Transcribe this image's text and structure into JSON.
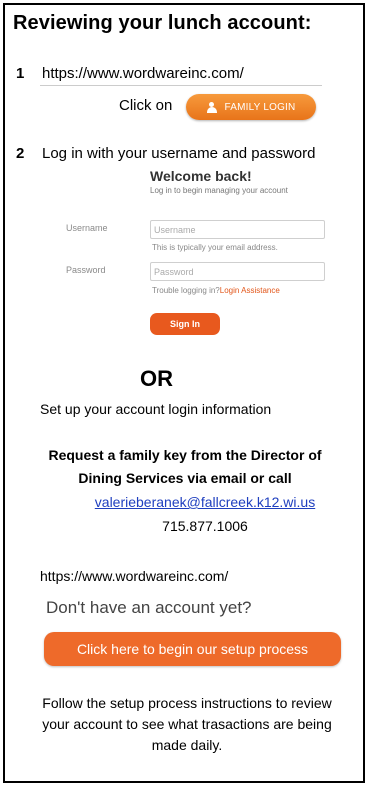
{
  "header": {
    "title": "Reviewing your lunch account:"
  },
  "step1": {
    "number": "1",
    "url": "https://www.wordwareinc.com/",
    "click_on": "Click on",
    "family_login_label": "FAMILY LOGIN"
  },
  "step2": {
    "number": "2",
    "instruction": "Log in with your username and password",
    "welcome": "Welcome back!",
    "welcome_sub": "Log in to begin managing your account",
    "username_label": "Username",
    "username_placeholder": "Username",
    "username_hint": "This is typically your email address.",
    "password_label": "Password",
    "password_placeholder": "Password",
    "trouble_text": "Trouble logging in?",
    "assistance_link": "Login Assistance",
    "signin_label": "Sign In"
  },
  "or_section": {
    "or": "OR",
    "setup_info": "Set up your account login information",
    "request_line1": "Request a family key from the Director of",
    "request_line2": "Dining Services via email or call",
    "email": "valerieberanek@fallcreek.k12.wi.us",
    "phone": "715.877.1006"
  },
  "setup": {
    "url": "https://www.wordwareinc.com/",
    "no_account": "Don't have an account yet?",
    "setup_button": "Click here to begin our setup process"
  },
  "footer": {
    "line1": "Follow the setup process instructions to review",
    "line2": "your account to see what trasactions are being",
    "line3": "made daily."
  },
  "colors": {
    "accent_orange": "#e8591e",
    "email_blue": "#1f3fbf"
  }
}
